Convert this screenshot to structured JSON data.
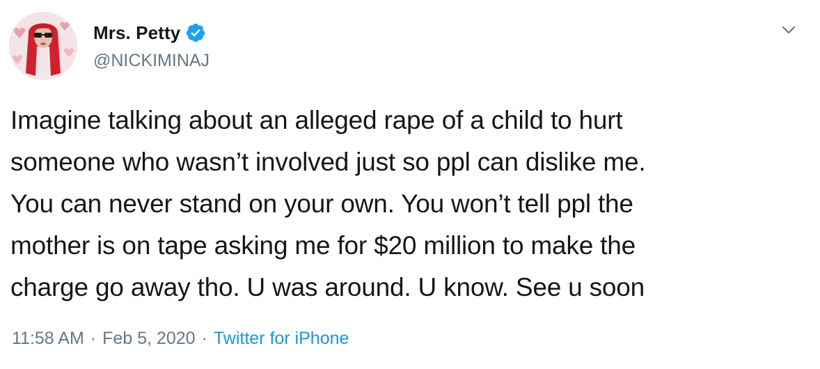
{
  "user": {
    "display_name": "Mrs. Petty",
    "handle": "@NICKIMINAJ",
    "verified": true,
    "avatar_icon": "profile-avatar"
  },
  "tweet": {
    "text": "Imagine talking about an alleged rape of a child to hurt\nsomeone who wasn’t involved just so ppl can dislike me.\nYou can never stand on your own. You won’t tell ppl the\nmother is on tape asking me for $20 million to make the\ncharge go away tho. U was around. U know. See u soon",
    "time": "11:58 AM",
    "separator": "·",
    "date": "Feb 5, 2020",
    "source": "Twitter for iPhone"
  },
  "icons": {
    "verified": "verified-badge-icon",
    "menu": "chevron-down-icon"
  },
  "colors": {
    "text": "#14171a",
    "secondary": "#657786",
    "link": "#1b95e0",
    "verified": "#1da1f2"
  }
}
